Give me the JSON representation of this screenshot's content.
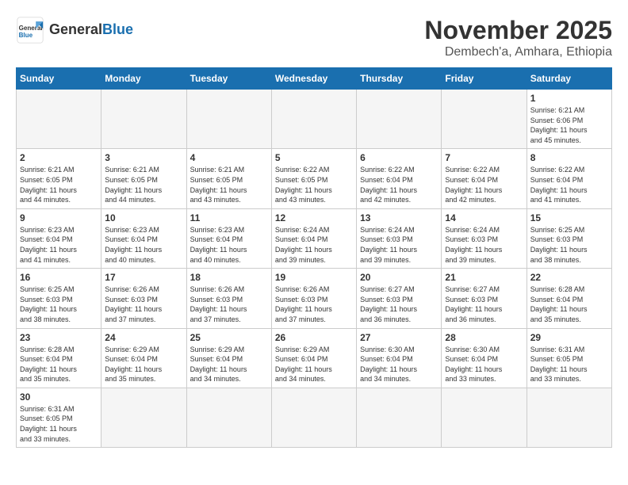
{
  "logo": {
    "text_general": "General",
    "text_blue": "Blue"
  },
  "title": "November 2025",
  "location": "Dembech'a, Amhara, Ethiopia",
  "days_of_week": [
    "Sunday",
    "Monday",
    "Tuesday",
    "Wednesday",
    "Thursday",
    "Friday",
    "Saturday"
  ],
  "weeks": [
    [
      {
        "day": "",
        "info": ""
      },
      {
        "day": "",
        "info": ""
      },
      {
        "day": "",
        "info": ""
      },
      {
        "day": "",
        "info": ""
      },
      {
        "day": "",
        "info": ""
      },
      {
        "day": "",
        "info": ""
      },
      {
        "day": "1",
        "info": "Sunrise: 6:21 AM\nSunset: 6:06 PM\nDaylight: 11 hours\nand 45 minutes."
      }
    ],
    [
      {
        "day": "2",
        "info": "Sunrise: 6:21 AM\nSunset: 6:05 PM\nDaylight: 11 hours\nand 44 minutes."
      },
      {
        "day": "3",
        "info": "Sunrise: 6:21 AM\nSunset: 6:05 PM\nDaylight: 11 hours\nand 44 minutes."
      },
      {
        "day": "4",
        "info": "Sunrise: 6:21 AM\nSunset: 6:05 PM\nDaylight: 11 hours\nand 43 minutes."
      },
      {
        "day": "5",
        "info": "Sunrise: 6:22 AM\nSunset: 6:05 PM\nDaylight: 11 hours\nand 43 minutes."
      },
      {
        "day": "6",
        "info": "Sunrise: 6:22 AM\nSunset: 6:04 PM\nDaylight: 11 hours\nand 42 minutes."
      },
      {
        "day": "7",
        "info": "Sunrise: 6:22 AM\nSunset: 6:04 PM\nDaylight: 11 hours\nand 42 minutes."
      },
      {
        "day": "8",
        "info": "Sunrise: 6:22 AM\nSunset: 6:04 PM\nDaylight: 11 hours\nand 41 minutes."
      }
    ],
    [
      {
        "day": "9",
        "info": "Sunrise: 6:23 AM\nSunset: 6:04 PM\nDaylight: 11 hours\nand 41 minutes."
      },
      {
        "day": "10",
        "info": "Sunrise: 6:23 AM\nSunset: 6:04 PM\nDaylight: 11 hours\nand 40 minutes."
      },
      {
        "day": "11",
        "info": "Sunrise: 6:23 AM\nSunset: 6:04 PM\nDaylight: 11 hours\nand 40 minutes."
      },
      {
        "day": "12",
        "info": "Sunrise: 6:24 AM\nSunset: 6:04 PM\nDaylight: 11 hours\nand 39 minutes."
      },
      {
        "day": "13",
        "info": "Sunrise: 6:24 AM\nSunset: 6:03 PM\nDaylight: 11 hours\nand 39 minutes."
      },
      {
        "day": "14",
        "info": "Sunrise: 6:24 AM\nSunset: 6:03 PM\nDaylight: 11 hours\nand 39 minutes."
      },
      {
        "day": "15",
        "info": "Sunrise: 6:25 AM\nSunset: 6:03 PM\nDaylight: 11 hours\nand 38 minutes."
      }
    ],
    [
      {
        "day": "16",
        "info": "Sunrise: 6:25 AM\nSunset: 6:03 PM\nDaylight: 11 hours\nand 38 minutes."
      },
      {
        "day": "17",
        "info": "Sunrise: 6:26 AM\nSunset: 6:03 PM\nDaylight: 11 hours\nand 37 minutes."
      },
      {
        "day": "18",
        "info": "Sunrise: 6:26 AM\nSunset: 6:03 PM\nDaylight: 11 hours\nand 37 minutes."
      },
      {
        "day": "19",
        "info": "Sunrise: 6:26 AM\nSunset: 6:03 PM\nDaylight: 11 hours\nand 37 minutes."
      },
      {
        "day": "20",
        "info": "Sunrise: 6:27 AM\nSunset: 6:03 PM\nDaylight: 11 hours\nand 36 minutes."
      },
      {
        "day": "21",
        "info": "Sunrise: 6:27 AM\nSunset: 6:03 PM\nDaylight: 11 hours\nand 36 minutes."
      },
      {
        "day": "22",
        "info": "Sunrise: 6:28 AM\nSunset: 6:04 PM\nDaylight: 11 hours\nand 35 minutes."
      }
    ],
    [
      {
        "day": "23",
        "info": "Sunrise: 6:28 AM\nSunset: 6:04 PM\nDaylight: 11 hours\nand 35 minutes."
      },
      {
        "day": "24",
        "info": "Sunrise: 6:29 AM\nSunset: 6:04 PM\nDaylight: 11 hours\nand 35 minutes."
      },
      {
        "day": "25",
        "info": "Sunrise: 6:29 AM\nSunset: 6:04 PM\nDaylight: 11 hours\nand 34 minutes."
      },
      {
        "day": "26",
        "info": "Sunrise: 6:29 AM\nSunset: 6:04 PM\nDaylight: 11 hours\nand 34 minutes."
      },
      {
        "day": "27",
        "info": "Sunrise: 6:30 AM\nSunset: 6:04 PM\nDaylight: 11 hours\nand 34 minutes."
      },
      {
        "day": "28",
        "info": "Sunrise: 6:30 AM\nSunset: 6:04 PM\nDaylight: 11 hours\nand 33 minutes."
      },
      {
        "day": "29",
        "info": "Sunrise: 6:31 AM\nSunset: 6:05 PM\nDaylight: 11 hours\nand 33 minutes."
      }
    ],
    [
      {
        "day": "30",
        "info": "Sunrise: 6:31 AM\nSunset: 6:05 PM\nDaylight: 11 hours\nand 33 minutes."
      },
      {
        "day": "",
        "info": ""
      },
      {
        "day": "",
        "info": ""
      },
      {
        "day": "",
        "info": ""
      },
      {
        "day": "",
        "info": ""
      },
      {
        "day": "",
        "info": ""
      },
      {
        "day": "",
        "info": ""
      }
    ]
  ]
}
